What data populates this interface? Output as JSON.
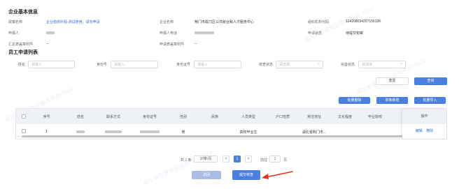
{
  "company_section": {
    "title": "企业基本信息",
    "fields": [
      {
        "label": "政策名称",
        "value": "企业稳岗补贴-测试使用，请勿申请"
      },
      {
        "label": "企业名称",
        "value": "荆门市掇刀区公共就业和人才服务中心"
      },
      {
        "label": "组织机构代码",
        "value": "12420803420715512K"
      },
      {
        "label": "申报人",
        "value": ""
      },
      {
        "label": "申报人电话",
        "value": ""
      },
      {
        "label": "申请状态",
        "value": "待提交初审"
      },
      {
        "label": "汇总表盖章附件",
        "value": "--"
      },
      {
        "label": "申请表盖章附件",
        "value": "--"
      }
    ]
  },
  "employee_section": {
    "title": "员工申请列表",
    "filters": [
      {
        "label": "姓名",
        "placeholder": "请输入"
      },
      {
        "label": "身份号",
        "placeholder": "请输入"
      },
      {
        "label": "身份证号",
        "placeholder": "请输入"
      },
      {
        "label": "核查状态",
        "placeholder": "请选择"
      },
      {
        "label": "完善状态",
        "placeholder": "请选择"
      }
    ],
    "reset_label": "重置",
    "search_label": "查询",
    "action_buttons": [
      "批量删除",
      "单条新增",
      "批量导入"
    ]
  },
  "table": {
    "columns": [
      "序号",
      "姓名",
      "联系方式",
      "身份证号",
      "性别",
      "民族",
      "人员类型",
      "户口性质",
      "常住地址",
      "文化程度",
      "毕业院校"
    ],
    "op_column": "操作",
    "rows": [
      {
        "index": "1",
        "name": "",
        "phone": "",
        "id_number": "",
        "gender": "男",
        "ethnicity": "",
        "person_type": "高校毕业生",
        "hukou": "",
        "address": "湖北省荆门市...",
        "education": "",
        "school": "",
        "op_edit": "编辑",
        "op_delete": "删除"
      }
    ]
  },
  "pagination": {
    "total_label": "共 1 条",
    "page_size": "10条/页",
    "current_page": "1",
    "prev": "<",
    "next": ">",
    "goto_prefix": "前往",
    "goto_value": "1",
    "goto_suffix": "页"
  },
  "footer": {
    "back_label": "返回",
    "submit_label": "提交核查"
  },
  "watermark_text": "湖北省智慧就业服务平台 2024",
  "colors": {
    "primary": "#4a7fe0",
    "link": "#2f6fd6",
    "arrow": "#e0331f",
    "header_bg": "#eef1f6"
  }
}
